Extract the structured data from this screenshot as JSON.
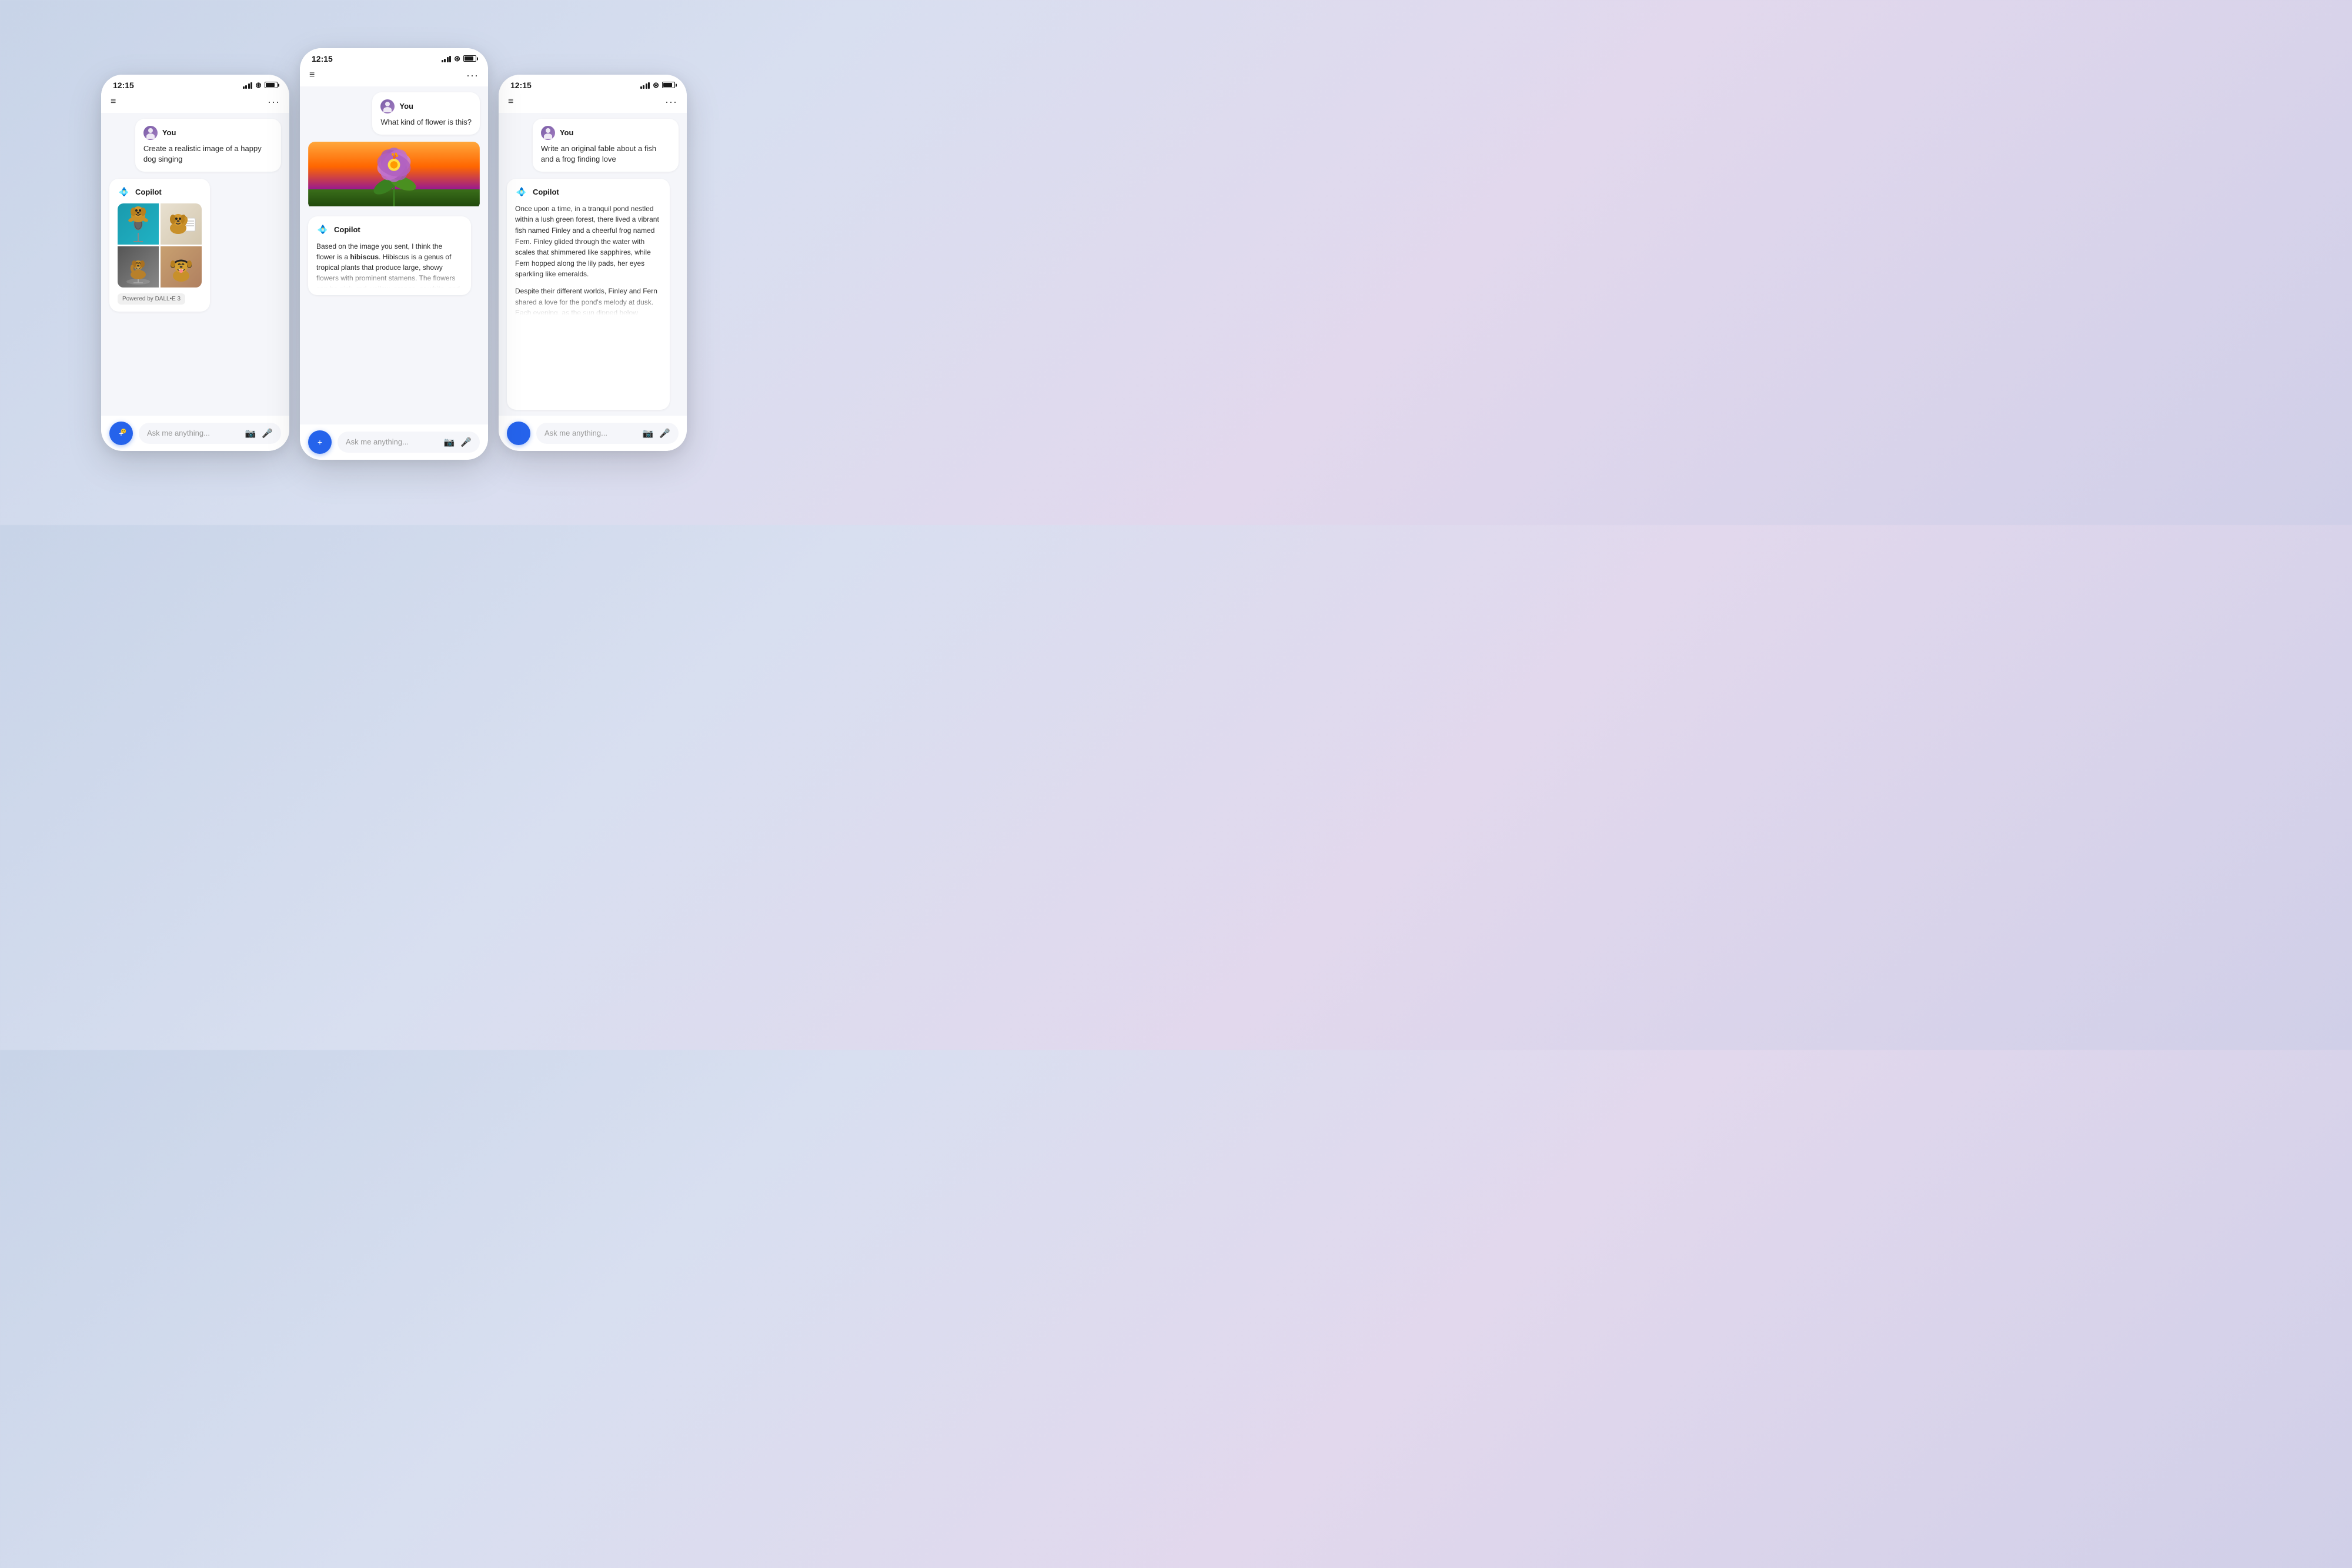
{
  "background": {
    "gradient_start": "#c8d4e8",
    "gradient_end": "#d0cfe8"
  },
  "phones": [
    {
      "id": "left",
      "status_bar": {
        "time": "12:15",
        "signal_label": "signal",
        "wifi_label": "wifi",
        "battery_label": "battery"
      },
      "nav": {
        "menu_icon": "≡",
        "more_icon": "···"
      },
      "user_message": {
        "user_label": "You",
        "text": "Create a realistic image of a happy dog singing"
      },
      "copilot_response": {
        "label": "Copilot",
        "image_grid": [
          {
            "id": 1,
            "alt": "Dog singing with microphone on teal background"
          },
          {
            "id": 2,
            "alt": "Dog holding sheet music"
          },
          {
            "id": 3,
            "alt": "Dog at microphone stand dark background"
          },
          {
            "id": 4,
            "alt": "Dog with headphones singing"
          }
        ],
        "badge": "Powered by DALL•E 3"
      },
      "input": {
        "placeholder": "Ask me anything...",
        "camera_label": "camera",
        "mic_label": "microphone"
      }
    },
    {
      "id": "center",
      "status_bar": {
        "time": "12:15"
      },
      "user_message": {
        "user_label": "You",
        "text": "What kind of flower is this?"
      },
      "copilot_response": {
        "label": "Copilot",
        "text": "Based on the image you sent, I think the flower is a hibiscus. Hibiscus is a genus of tropical plants that produce large, showy flowers with prominent stamens. The flowers can be pink, red, yellow, orange, or white, and they often have a contrasting eye in the"
      },
      "input": {
        "placeholder": "Ask me anything..."
      }
    },
    {
      "id": "right",
      "status_bar": {
        "time": "12:15"
      },
      "user_message": {
        "user_label": "You",
        "text": "Write an original fable about a fish and a frog finding love"
      },
      "copilot_response": {
        "label": "Copilot",
        "paragraph1": "Once upon a time, in a tranquil pond nestled within a lush green forest, there lived a vibrant fish named Finley and a cheerful frog named Fern. Finley glided through the water with scales that shimmered like sapphires, while Fern hopped along the lily pads, her eyes sparkling like emeralds.",
        "paragraph2": "Despite their different worlds, Finley and Fern shared a love for the pond's melody at dusk. Each evening, as the sun dipped below"
      },
      "input": {
        "placeholder": "Ask me anything...",
        "camera_label": "camera",
        "mic_label": "microphone"
      }
    }
  ]
}
